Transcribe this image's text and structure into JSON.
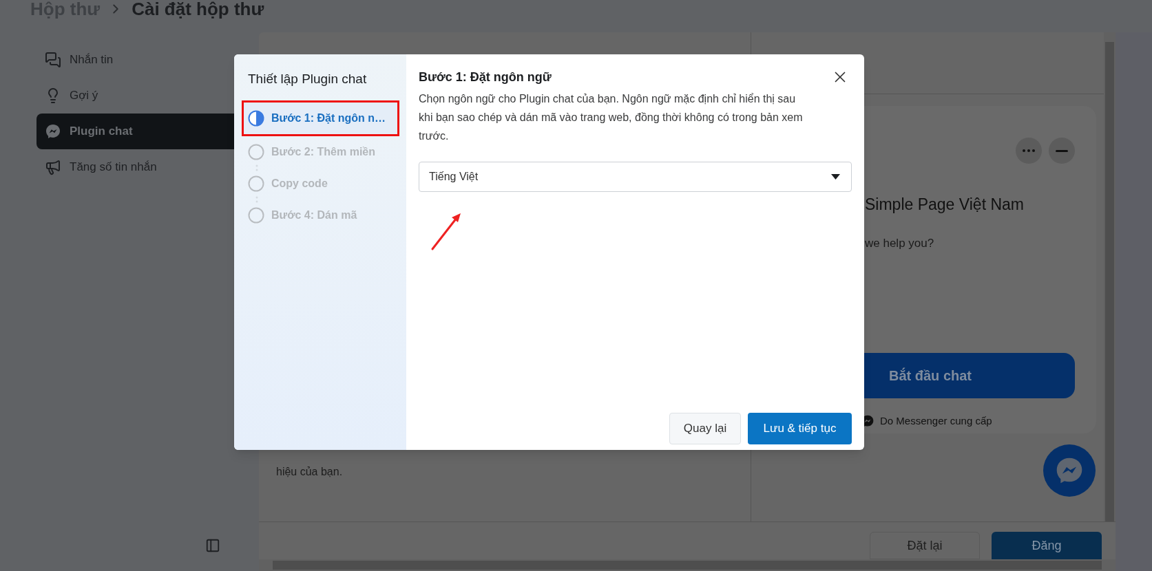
{
  "breadcrumb": {
    "parent": "Hộp thư",
    "current": "Cài đặt hộp thư"
  },
  "sidebar": {
    "items": [
      {
        "label": "Nhắn tin",
        "selected": false
      },
      {
        "label": "Gợi ý",
        "selected": false
      },
      {
        "label": "Plugin chat",
        "selected": true
      },
      {
        "label": "Tăng số tin nhắn",
        "selected": false
      }
    ]
  },
  "background_panel": {
    "description_tail": "hiệu của bạn."
  },
  "preview": {
    "page_name": "Simple Page Việt Nam",
    "greeting": "we help you?",
    "start_button": "Bắt đầu chat",
    "footer": "Do Messenger cung cấp"
  },
  "footer_buttons": [
    {
      "label": "Đặt lại",
      "kind": "secondary"
    },
    {
      "label": "Đăng",
      "kind": "primary"
    }
  ],
  "modal": {
    "sidebar_title": "Thiết lập Plugin chat",
    "steps": [
      {
        "label": "Bước 1: Đặt ngôn n…",
        "selected": true
      },
      {
        "label": "Bước 2: Thêm miền",
        "selected": false
      },
      {
        "label": "Copy code",
        "selected": false
      },
      {
        "label": "Bước 4: Dán mã",
        "selected": false
      }
    ],
    "title": "Bước 1: Đặt ngôn ngữ",
    "description": "Chọn ngôn ngữ cho Plugin chat của bạn. Ngôn ngữ mặc định chỉ hiển thị sau khi bạn sao chép và dán mã vào trang web, đồng thời không có trong bản xem trước.",
    "language_select": {
      "value": "Tiếng Việt"
    },
    "buttons": [
      {
        "label": "Quay lại",
        "kind": "secondary"
      },
      {
        "label": "Lưu & tiếp tục",
        "kind": "primary"
      }
    ]
  }
}
